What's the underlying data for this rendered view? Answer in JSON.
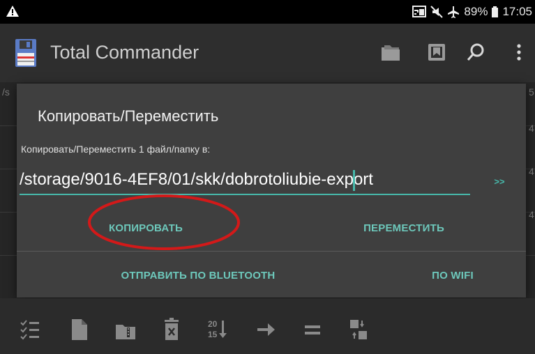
{
  "status_bar": {
    "battery_percent": "89%",
    "time": "17:05",
    "icons": [
      "warning-icon",
      "cast-icon",
      "mute-icon",
      "airplane-icon",
      "battery-icon"
    ]
  },
  "app_bar": {
    "title": "Total Commander",
    "icons": [
      "save-icon",
      "folder-icon",
      "bookmark-icon",
      "search-icon",
      "menu-icon"
    ]
  },
  "background_list": {
    "left_peek": "/s",
    "right_peek": [
      "5",
      "4",
      "4",
      "4"
    ]
  },
  "dialog": {
    "title": "Копировать/Переместить",
    "subtitle": "Копировать/Переместить 1 файл/папку в:",
    "path_value": "/storage/9016-4EF8/01/skk/dobrotoliubie-export",
    "browse_label": ">>",
    "copy_label": "КОПИРОВАТЬ",
    "move_label": "ПЕРЕМЕСТИТЬ",
    "bluetooth_label": "ОТПРАВИТЬ ПО BLUETOOTH",
    "wifi_label": "ПО WIFI"
  },
  "colors": {
    "accent": "#47b9ab",
    "annotation": "#d31919",
    "dialog_bg": "#3f3f3f",
    "screen_bg": "#2b2b2b"
  },
  "toolbar": {
    "icons": [
      "select-icon",
      "new-file-icon",
      "archive-icon",
      "delete-icon",
      "sort-icon",
      "arrow-right-icon",
      "equal-icon",
      "swap-panels-icon"
    ]
  }
}
